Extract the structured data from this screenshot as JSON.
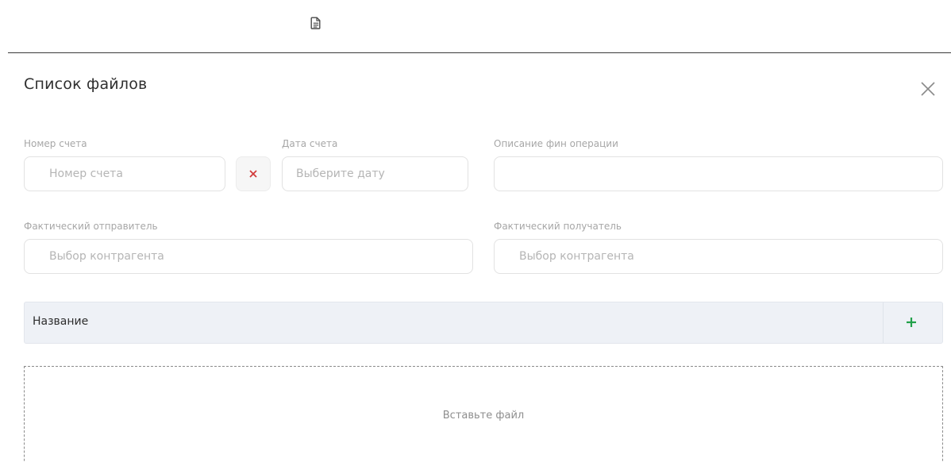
{
  "toolbar": {
    "icon": "file-document-icon"
  },
  "modal": {
    "title": "Список файлов",
    "close_icon": "close-icon"
  },
  "form": {
    "invoice_number": {
      "label": "Номер счета",
      "placeholder": "Номер счета",
      "value": ""
    },
    "clear_button_icon": "clear-x-icon",
    "invoice_date": {
      "label": "Дата счета",
      "placeholder": "Выберите дату",
      "value": ""
    },
    "operation_description": {
      "label": "Описание фин операции",
      "placeholder": "",
      "value": ""
    },
    "actual_sender": {
      "label": "Фактический отправитель",
      "placeholder": "Выбор контрагента",
      "value": ""
    },
    "actual_recipient": {
      "label": "Фактический получатель",
      "placeholder": "Выбор контрагента",
      "value": ""
    }
  },
  "table": {
    "columns": [
      "Название"
    ],
    "add_icon": "plus-icon"
  },
  "dropzone": {
    "text": "Вставьте файл"
  },
  "colors": {
    "accent_green": "#22a14a",
    "clear_red": "#d23b3b",
    "header_bg": "#eef1f6"
  }
}
